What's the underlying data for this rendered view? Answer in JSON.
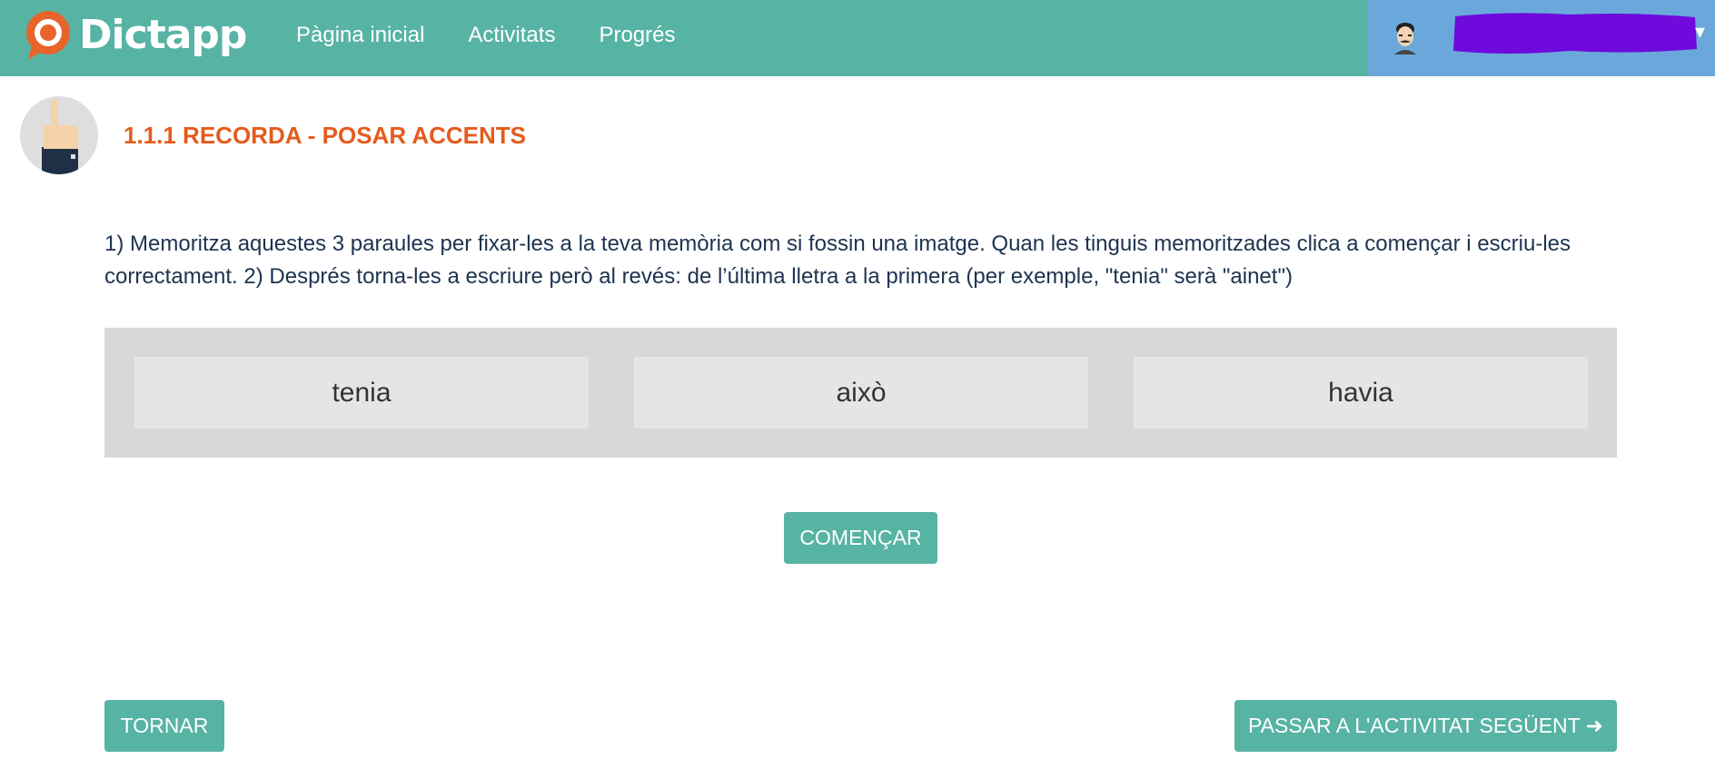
{
  "app": {
    "name": "Dictapp",
    "colors": {
      "header": "#57b3a4",
      "accent": "#e55b1c",
      "user_area": "#6aa8dc",
      "button": "#57b3a4",
      "text": "#1d3350"
    }
  },
  "nav": {
    "items": [
      {
        "label": "Pàgina inicial"
      },
      {
        "label": "Activitats"
      },
      {
        "label": "Progrés"
      }
    ]
  },
  "user": {
    "avatar_icon": "user-avatar-icon",
    "name_redacted": true
  },
  "activity": {
    "icon": "pointing-hand-icon",
    "title": "1.1.1 RECORDA - POSAR ACCENTS",
    "instructions": "1) Memoritza aquestes 3 paraules per fixar-les a la teva memòria com si fossin una imatge. Quan les tinguis memoritzades clica a començar i escriu-les correctament. 2) Després torna-les a escriure però al revés: de l’última lletra a la primera (per exemple, \"tenia\" serà \"ainet\")",
    "words": [
      "tenia",
      "això",
      "havia"
    ]
  },
  "buttons": {
    "start": "COMENÇAR",
    "back": "TORNAR",
    "next": "PASSAR A L'ACTIVITAT SEGÜENT ➜"
  }
}
